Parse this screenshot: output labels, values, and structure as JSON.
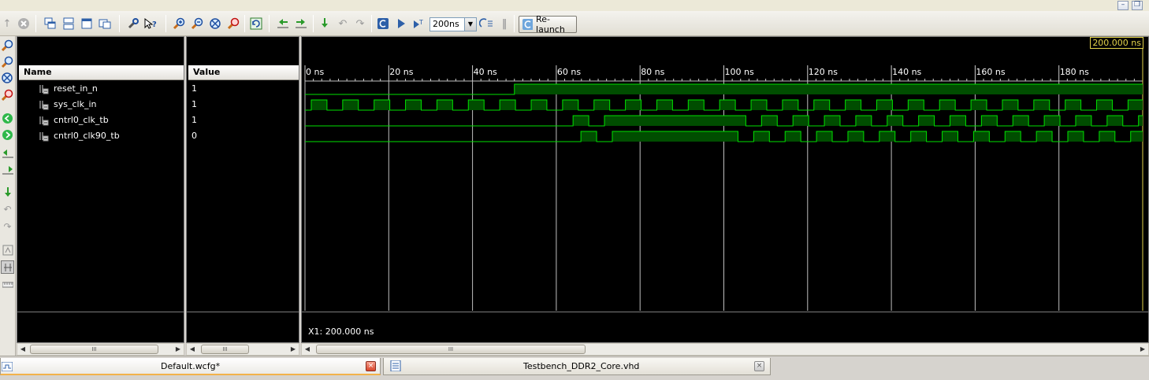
{
  "window": {
    "minimize_glyph": "–",
    "restore_glyph": "❐"
  },
  "toolbar": {
    "time_value": "200ns",
    "relaunch_label": "Re-launch",
    "icons": [
      "back-arrow-icon",
      "stop-icon",
      "cascade-icon",
      "tile-horizontal-icon",
      "tile-vertical-icon",
      "restore-windows-icon",
      "wrench-icon",
      "context-help-icon",
      "zoom-in-icon",
      "zoom-out-icon",
      "zoom-fit-icon",
      "zoom-to-cursor-icon",
      "refresh-icon",
      "go-to-start-icon",
      "go-to-end-icon",
      "step-icon",
      "undo-icon",
      "redo-icon",
      "restart-icon",
      "run-icon",
      "run-for-time-icon",
      "step-over-icon",
      "pause-icon"
    ]
  },
  "columns": {
    "name_header": "Name",
    "value_header": "Value"
  },
  "signals": [
    {
      "name": "reset_in_n",
      "value": "1"
    },
    {
      "name": "sys_clk_in",
      "value": "1"
    },
    {
      "name": "cntrl0_clk_tb",
      "value": "1"
    },
    {
      "name": "cntrl0_clk90_tb",
      "value": "0"
    }
  ],
  "wave": {
    "time_labels": [
      "0 ns",
      "20 ns",
      "40 ns",
      "60 ns",
      "80 ns",
      "100 ns",
      "120 ns",
      "140 ns",
      "160 ns",
      "180 ns"
    ],
    "time_start_ns": 0,
    "time_end_ns": 200,
    "cursor_label": "200.000 ns",
    "x1_readout": "X1: 200.000 ns",
    "trace_color": "#00e000",
    "fill_color": "#004d00",
    "grid_color": "#bfbfbf",
    "reset_rise_ns": 50,
    "sys_clk_half_period_ns": 3.75,
    "cntrl0_start_ns": 64,
    "cntrl0_gap": [
      75,
      102
    ],
    "cntrl0_half_period_ns": 3.75
  },
  "tabs": [
    {
      "label": "Default.wcfg*",
      "close": "×"
    },
    {
      "label": "Testbench_DDR2_Core.vhd",
      "close": "×"
    }
  ],
  "scroll": {
    "thumb_glyph": "III"
  }
}
